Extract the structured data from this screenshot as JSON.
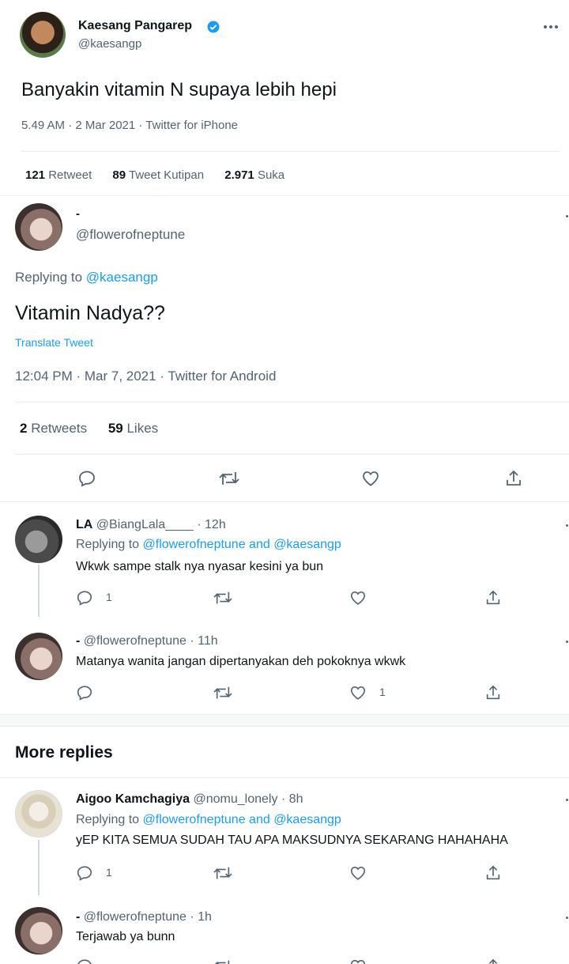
{
  "original_tweet": {
    "name": "Kaesang Pangarep",
    "handle": "@kaesangp",
    "text": "Banyakin vitamin N supaya lebih hepi",
    "meta": "5.49 AM · 2 Mar 2021 · Twitter for iPhone",
    "retweet_count": "121",
    "retweet_label": "Retweet",
    "quote_count": "89",
    "quote_label": "Tweet Kutipan",
    "like_count": "2.971",
    "like_label": "Suka"
  },
  "main_tweet": {
    "name": "-",
    "handle": "@flowerofneptune",
    "replying_prefix": "Replying to",
    "replying_to": "@kaesangp",
    "text": "Vitamin Nadya??",
    "translate": "Translate Tweet",
    "meta": "12:04 PM · Mar 7, 2021 · Twitter for Android",
    "retweet_count": "2",
    "retweet_label": "Retweets",
    "like_count": "59",
    "like_label": "Likes"
  },
  "replies": [
    {
      "name": "LA",
      "handle": "@BiangLala____",
      "time": "· 12h",
      "replying_prefix": "Replying to",
      "replying_to": "@flowerofneptune and @kaesangp",
      "text": "Wkwk sampe stalk nya nyasar kesini ya bun",
      "reply_count": "1",
      "like_count": ""
    },
    {
      "name": "-",
      "handle": "@flowerofneptune",
      "time": "· 11h",
      "text": "Matanya wanita jangan dipertanyakan deh pokoknya wkwk",
      "reply_count": "",
      "like_count": "1"
    }
  ],
  "more_replies": {
    "heading": "More replies",
    "items": [
      {
        "name": "Aigoo Kamchagiya",
        "handle": "@nomu_lonely",
        "time": "· 8h",
        "replying_prefix": "Replying to",
        "replying_to": "@flowerofneptune and @kaesangp",
        "text": "yEP KITA SEMUA SUDAH TAU APA MAKSUDNYA SEKARANG HAHAHAHA",
        "reply_count": "1"
      },
      {
        "name": "-",
        "handle": "@flowerofneptune",
        "time": "· 1h",
        "text": "Terjawab ya bunn"
      }
    ]
  },
  "icons": {
    "more": "more-dots-icon",
    "verified": "verified-badge-icon",
    "reply": "reply-icon",
    "retweet": "retweet-icon",
    "like": "heart-icon",
    "share": "share-icon"
  },
  "colors": {
    "accent": "#1d9bf0",
    "muted": "#536471",
    "divider": "#e6ecf0",
    "section_gap": "#f7f9f9"
  }
}
